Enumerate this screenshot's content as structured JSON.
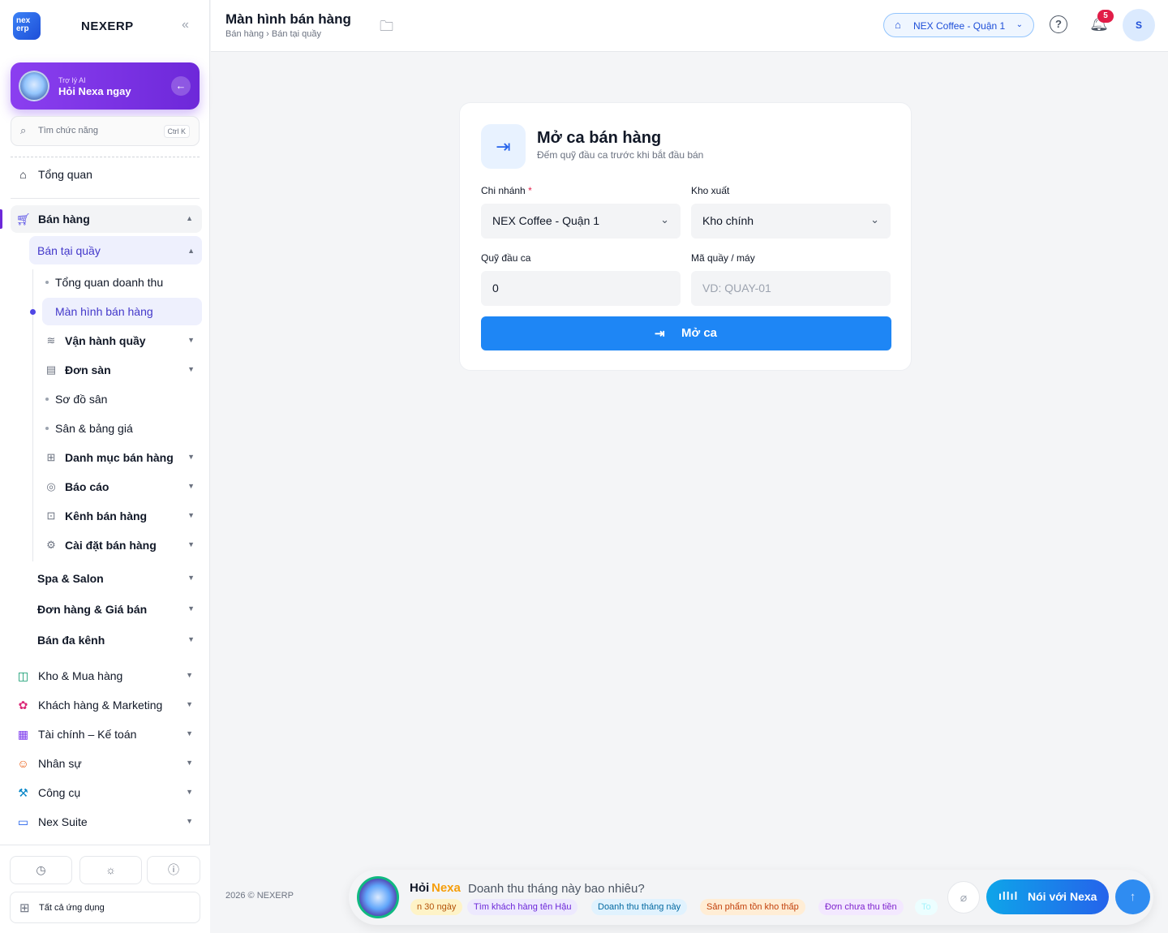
{
  "brand": {
    "name": "NEXERP",
    "logo_text": "nex erp"
  },
  "sidebar": {
    "ai_card": {
      "small": "Trợ lý AI",
      "title": "Hỏi Nexa ngay"
    },
    "search": {
      "placeholder": "Tìm chức năng",
      "shortcut": "Ctrl K"
    },
    "overview": "Tổng quan",
    "sales": {
      "label": "Bán hàng",
      "counter": "Bán tại quầy",
      "items": [
        {
          "label": "Tổng quan doanh thu"
        },
        {
          "label": "Màn hình bán hàng"
        },
        {
          "label": "Vận hành quầy"
        },
        {
          "label": "Đơn sàn"
        },
        {
          "label": "Sơ đồ sân"
        },
        {
          "label": "Sân & bảng giá"
        },
        {
          "label": "Danh mục bán hàng"
        },
        {
          "label": "Báo cáo"
        },
        {
          "label": "Kênh bán hàng"
        },
        {
          "label": "Cài đặt bán hàng"
        }
      ],
      "groups": [
        {
          "label": "Spa & Salon"
        },
        {
          "label": "Đơn hàng & Giá bán"
        },
        {
          "label": "Bán đa kênh"
        }
      ]
    },
    "modules": [
      {
        "label": "Kho & Mua hàng"
      },
      {
        "label": "Khách hàng & Marketing"
      },
      {
        "label": "Tài chính – Kế toán"
      },
      {
        "label": "Nhân sự"
      },
      {
        "label": "Công cụ"
      },
      {
        "label": "Nex Suite"
      }
    ],
    "all_apps": "Tất cả ứng dụng"
  },
  "topbar": {
    "title": "Màn hình bán hàng",
    "breadcrumb": "Bán hàng › Bán tại quầy",
    "branch": "NEX Coffee - Quận 1",
    "notifications": "5",
    "avatar": "S"
  },
  "card": {
    "title": "Mở ca bán hàng",
    "subtitle": "Đếm quỹ đầu ca trước khi bắt đầu bán",
    "branch_label": "Chi nhánh",
    "branch_value": "NEX Coffee - Quận 1",
    "warehouse_label": "Kho xuất",
    "warehouse_value": "Kho chính",
    "fund_label": "Quỹ đầu ca",
    "fund_value": "0",
    "counter_label": "Mã quầy / máy",
    "counter_placeholder": "VD: QUAY-01",
    "submit": "Mở ca"
  },
  "footer": {
    "copyright": "2026 © NEXERP"
  },
  "chat": {
    "ask": "Hỏi",
    "nexa": "Nexa",
    "placeholder": "Doanh thu tháng này bao nhiêu?",
    "chips": [
      {
        "label": "n 30 ngày",
        "bg": "#fef3c7",
        "color": "#b45309"
      },
      {
        "label": "Tìm khách hàng tên Hậu",
        "bg": "#ede9fe",
        "color": "#6d28d9"
      },
      {
        "label": "Doanh thu tháng này",
        "bg": "#e0f2fe",
        "color": "#0369a1"
      },
      {
        "label": "Sản phẩm tồn kho thấp",
        "bg": "#ffedd5",
        "color": "#c2410c"
      },
      {
        "label": "Đơn chưa thu tiền",
        "bg": "#f3e8ff",
        "color": "#7e22ce"
      },
      {
        "label": "To",
        "bg": "#ecfeff",
        "color": "#a5f3fc"
      }
    ],
    "voice": "Nói với Nexa"
  },
  "colors": {
    "primary": "#1e86f5",
    "accent": "#6d28d9",
    "badge": "#e11d48"
  }
}
